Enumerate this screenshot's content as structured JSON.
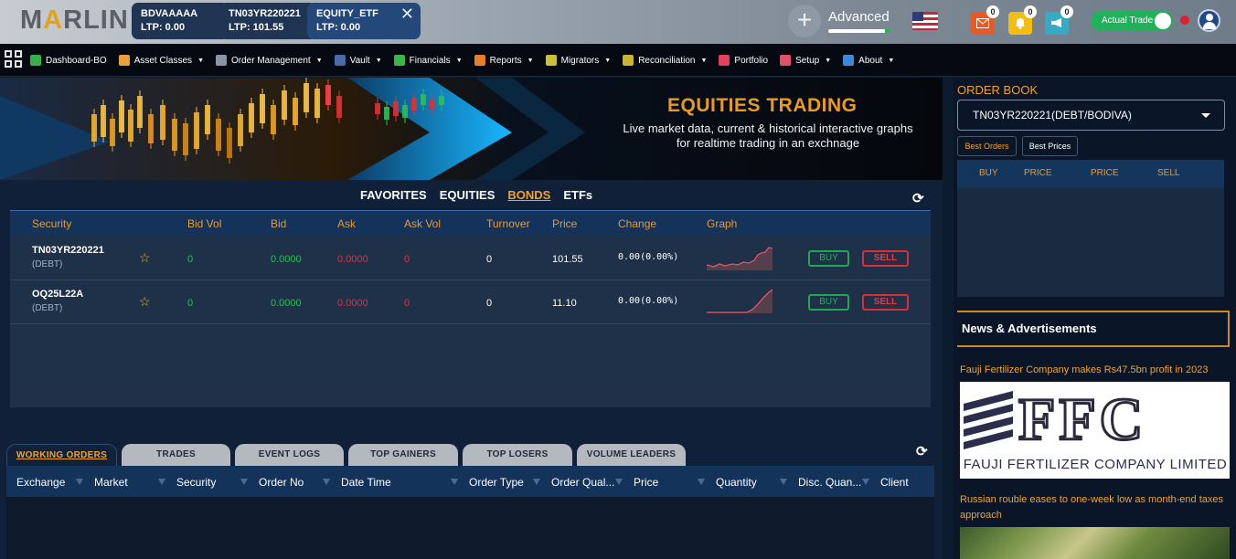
{
  "brand": {
    "logo_pre": "M",
    "logo_a": "A",
    "logo_post": "RLIN"
  },
  "tickers": [
    {
      "symbol": "BDVAAAAA",
      "ltp": "LTP: 0.00"
    },
    {
      "symbol": "TN03YR220221",
      "ltp": "LTP: 101.55"
    },
    {
      "symbol": "EQUITY_ETF",
      "ltp": "LTP: 0.00",
      "close": "✕"
    }
  ],
  "header": {
    "add_label": "+",
    "mode_label": "Advanced",
    "notifications": [
      {
        "icon": "mail-icon",
        "count": "0"
      },
      {
        "icon": "bell-icon",
        "count": "0"
      },
      {
        "icon": "megaphone-icon",
        "count": "0"
      }
    ],
    "trade_toggle_label": "Actual Trade",
    "trade_toggle_on": true
  },
  "nav": [
    {
      "label": "Dashboard-BO",
      "icon": "dashboard-icon",
      "color": "#35b34a",
      "dropdown": false
    },
    {
      "label": "Asset Classes",
      "icon": "asset-classes-icon",
      "color": "#e9a23b",
      "dropdown": true
    },
    {
      "label": "Order Management",
      "icon": "order-management-icon",
      "color": "#8a96a6",
      "dropdown": true
    },
    {
      "label": "Vault",
      "icon": "vault-icon",
      "color": "#4a6aa8",
      "dropdown": true
    },
    {
      "label": "Financials",
      "icon": "financials-icon",
      "color": "#3cb44b",
      "dropdown": true
    },
    {
      "label": "Reports",
      "icon": "reports-icon",
      "color": "#e77e2c",
      "dropdown": true
    },
    {
      "label": "Migrators",
      "icon": "migrators-icon",
      "color": "#cdbf3a",
      "dropdown": true
    },
    {
      "label": "Reconciliation",
      "icon": "reconciliation-icon",
      "color": "#c9b531",
      "dropdown": true
    },
    {
      "label": "Portfolio",
      "icon": "portfolio-icon",
      "color": "#e0435b",
      "dropdown": false
    },
    {
      "label": "Setup",
      "icon": "setup-gear-icon",
      "color": "#e2506d",
      "dropdown": true
    },
    {
      "label": "About",
      "icon": "about-globe-icon",
      "color": "#3f8ad8",
      "dropdown": true
    }
  ],
  "banner": {
    "title": "EQUITIES TRADING",
    "subtitle": "Live market data, current & historical interactive graphs for realtime trading in an exchnage"
  },
  "market_tabs": [
    {
      "label": "FAVORITES",
      "active": false
    },
    {
      "label": "EQUITIES",
      "active": false
    },
    {
      "label": "BONDS",
      "active": true
    },
    {
      "label": "ETFs",
      "active": false
    }
  ],
  "market_table": {
    "columns": [
      "Security",
      "Bid Vol",
      "Bid",
      "Ask",
      "Ask Vol",
      "Turnover",
      "Price",
      "Change",
      "Graph"
    ],
    "rows": [
      {
        "security": "TN03YR220221",
        "type": "(DEBT)",
        "bid_vol": "0",
        "bid": "0.0000",
        "ask": "0.0000",
        "ask_vol": "0",
        "turnover": "0",
        "price": "101.55",
        "change": "0.00(0.00%)",
        "buy": "BUY",
        "sell": "SELL"
      },
      {
        "security": "OQ25L22A",
        "type": "(DEBT)",
        "bid_vol": "0",
        "bid": "0.0000",
        "ask": "0.0000",
        "ask_vol": "0",
        "turnover": "0",
        "price": "11.10",
        "change": "0.00(0.00%)",
        "buy": "BUY",
        "sell": "SELL"
      }
    ]
  },
  "orders_tabs": [
    {
      "label": "WORKING ORDERS",
      "active": true
    },
    {
      "label": "TRADES",
      "active": false
    },
    {
      "label": "EVENT LOGS",
      "active": false
    },
    {
      "label": "TOP GAINERS",
      "active": false
    },
    {
      "label": "TOP LOSERS",
      "active": false
    },
    {
      "label": "VOLUME LEADERS",
      "active": false
    }
  ],
  "orders_table": {
    "columns": [
      "Exchange",
      "Market",
      "Security",
      "Order No",
      "Date Time",
      "Order Type",
      "Order Qual...",
      "Price",
      "Quantity",
      "Disc. Quan...",
      "Client"
    ]
  },
  "order_book": {
    "title": "ORDER BOOK",
    "selected_security": "TN03YR220221(DEBT/BODIVA)",
    "tabs": [
      "Best Orders",
      "Best Prices"
    ],
    "columns": [
      "BUY",
      "PRICE",
      "PRICE",
      "SELL"
    ]
  },
  "news": {
    "title": "News & Advertisements",
    "items": [
      {
        "headline": "Fauji Fertilizer Company makes Rs47.5bn profit in 2023",
        "image_logo_text": "FFC",
        "image_caption": "FAUJI FERTILIZER COMPANY LIMITED"
      },
      {
        "headline": "Russian rouble eases to one-week low as month-end taxes approach"
      }
    ]
  },
  "colors": {
    "accent": "#f0a32d",
    "buy": "#22b45b",
    "sell": "#e0303e",
    "header_blue": "#13335a"
  }
}
